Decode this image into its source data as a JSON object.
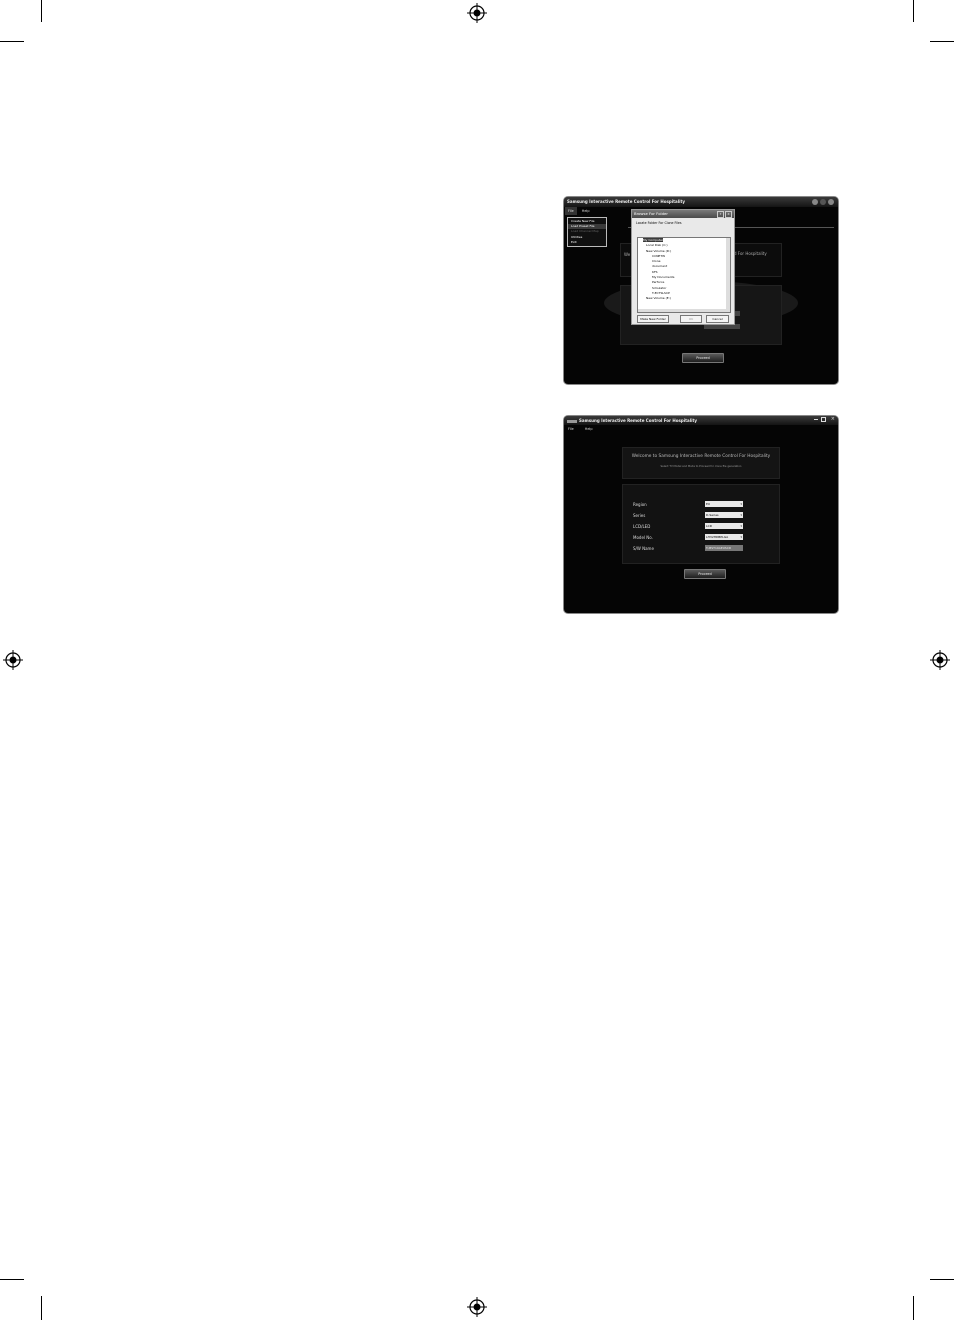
{
  "shot1": {
    "title": "Samsung Interactive Remote Control For Hospitality",
    "menu": [
      "File",
      "Help"
    ],
    "file_menu": [
      "Create New File",
      "Load Preset File",
      "Load Channel Map",
      "Utilities",
      "Exit"
    ],
    "dialog": {
      "title": "Browse For Folder",
      "help": "?",
      "close": "X",
      "prompt": "Locate Folder For Clone Files",
      "tree": [
        "My Computer",
        "Local Disk (C:)",
        "New Volume (D:)",
        "CCNETW",
        "Clone",
        "document",
        "KFS",
        "My Documents",
        "Perforce",
        "Simulator",
        "T-ECTSLSCP",
        "New Volume (E:)"
      ],
      "make_folder": "Make New Folder",
      "ok": "OK",
      "cancel": "Cancel"
    },
    "behind_text": "d For Hospitality",
    "welcome_partial": "We",
    "proceed": "Proceed"
  },
  "shot2": {
    "title": "Samsung Interactive Remote Control For Hospitality",
    "menu": [
      "File",
      "Help"
    ],
    "welcome": "Welcome to Samsung Interactive Remote Control For Hospitality",
    "subtitle": "Select TV Model and Mode to Proceed for clone file generation",
    "labels": [
      "Region",
      "Series",
      "LCD/LED",
      "Model No.",
      "S/W Name"
    ],
    "values": [
      "EU",
      "D-Series",
      "LCD",
      "LH32HDBPLGA",
      "T-MST10AEUSCD"
    ],
    "proceed": "Proceed"
  }
}
